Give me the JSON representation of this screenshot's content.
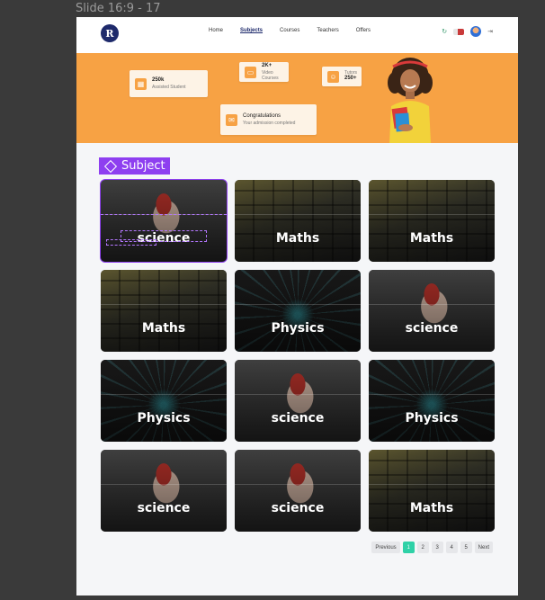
{
  "slide": {
    "label": "Slide 16:9 - 17"
  },
  "navbar": {
    "logo": "R",
    "links": [
      {
        "label": "Home",
        "active": false
      },
      {
        "label": "Subjects",
        "active": true
      },
      {
        "label": "Courses",
        "active": false
      },
      {
        "label": "Teachers",
        "active": false
      },
      {
        "label": "Offers",
        "active": false
      }
    ]
  },
  "hero": {
    "stats": [
      {
        "title": "250k",
        "subtitle": "Assisted Student",
        "icon": "calendar-icon"
      },
      {
        "title": "2K+",
        "subtitle": "Video Courses",
        "icon": "video-icon"
      },
      {
        "title": "250+",
        "subtitle": "Tutors",
        "icon": "tutor-icon"
      },
      {
        "title": "Congratulations",
        "subtitle": "Your admission completed",
        "icon": "mail-icon"
      }
    ],
    "accent": "#f7a244"
  },
  "section": {
    "title": "Subject",
    "accent": "#8e3ff0"
  },
  "subjects": [
    {
      "label": "science",
      "kind": "sci"
    },
    {
      "label": "Maths",
      "kind": "math"
    },
    {
      "label": "Maths",
      "kind": "math"
    },
    {
      "label": "Maths",
      "kind": "math"
    },
    {
      "label": "Physics",
      "kind": "phy"
    },
    {
      "label": "science",
      "kind": "sci"
    },
    {
      "label": "Physics",
      "kind": "phy"
    },
    {
      "label": "science",
      "kind": "sci"
    },
    {
      "label": "Physics",
      "kind": "phy"
    },
    {
      "label": "science",
      "kind": "sci"
    },
    {
      "label": "science",
      "kind": "sci"
    },
    {
      "label": "Maths",
      "kind": "math"
    }
  ],
  "pagination": {
    "previous": "Previous",
    "pages": [
      "1",
      "2",
      "3",
      "4",
      "5"
    ],
    "current": "1",
    "next": "Next",
    "active_color": "#2fd1a7"
  }
}
